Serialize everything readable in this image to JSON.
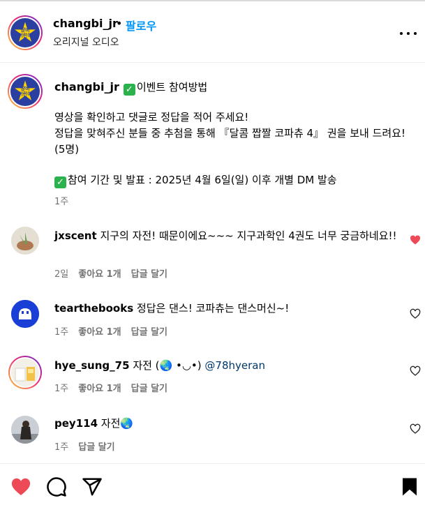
{
  "header": {
    "username": "changbi_jr",
    "separator": "•",
    "follow_label": "팔로우",
    "subtitle": "오리지널 오디오",
    "avatar_text_1": "창비",
    "avatar_text_2": "어린이"
  },
  "caption": {
    "username": "changbi_jr",
    "headline": "이벤트 참여방법",
    "line1": "영상을 확인하고 댓글로 정답을 적어 주세요!",
    "line2": "정답을 맞혀주신 분들 중 추첨을 통해 『달콤 짭짤 코파츄 4』 권을 보내 드려요!(5명)",
    "period": "참여 기간 및 발표 : 2025년 4월 6일(일) 이후 개별 DM 발송",
    "check_glyph": "✓",
    "time": "1주"
  },
  "comments": [
    {
      "username": "jxscent",
      "text": "지구의 자전! 때문이에요~~~ 지구과학인 4권도 너무 궁금하네요!!",
      "time": "2일",
      "likes": "좋아요 1개",
      "reply": "답글 달기",
      "liked": true
    },
    {
      "username": "tearthebooks",
      "text": "정답은 댄스! 코파츄는 댄스머신~!",
      "time": "1주",
      "likes": "좋아요 1개",
      "reply": "답글 달기",
      "liked": false
    },
    {
      "username": "hye_sung_75",
      "text": "자전 (🌏 •◡•)",
      "mention": "@78hyeran",
      "time": "1주",
      "likes": "좋아요 1개",
      "reply": "답글 달기",
      "liked": false
    },
    {
      "username": "pey114",
      "text": "자전🌏",
      "time": "1주",
      "reply": "답글 달기",
      "liked": false
    }
  ],
  "colors": {
    "accent_blue": "#0095f6",
    "like_red": "#ed4956",
    "muted": "#737373",
    "check_green": "#2bb24c"
  },
  "actions": {
    "like_icon": "heart-filled-icon",
    "comment_icon": "comment-bubble-icon",
    "share_icon": "paper-plane-icon",
    "save_icon": "bookmark-filled-icon"
  }
}
